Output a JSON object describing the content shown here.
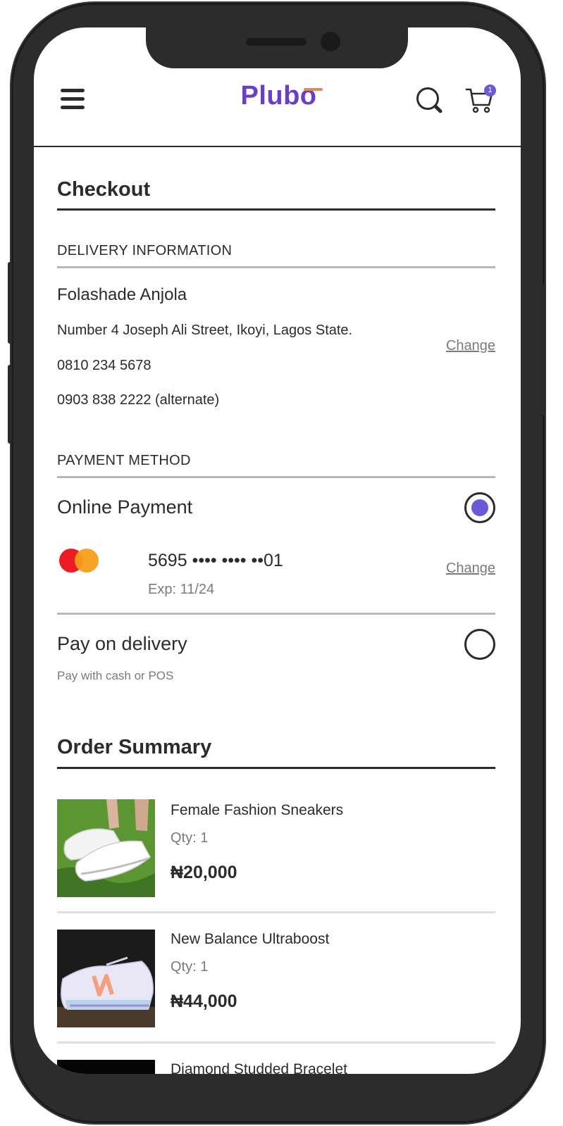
{
  "header": {
    "logo_text": "Plubo",
    "cart_count": "1"
  },
  "checkout": {
    "title": "Checkout"
  },
  "delivery": {
    "section_label": "DELIVERY INFORMATION",
    "name": "Folashade Anjola",
    "address": "Number 4 Joseph Ali Street, Ikoyi, Lagos State.",
    "phone": "0810 234 5678",
    "alt_phone": "0903 838 2222 (alternate)",
    "change_label": "Change"
  },
  "payment": {
    "section_label": "PAYMENT METHOD",
    "online": {
      "label": "Online Payment",
      "selected": true,
      "card_number": "5695 •••• •••• ••01",
      "card_expiry": "Exp: 11/24",
      "change_label": "Change"
    },
    "delivery_option": {
      "label": "Pay on delivery",
      "description": "Pay with cash or POS",
      "selected": false
    }
  },
  "order_summary": {
    "title": "Order Summary",
    "items": [
      {
        "name": "Female Fashion Sneakers",
        "qty": "Qty: 1",
        "price": "₦20,000"
      },
      {
        "name": "New Balance Ultraboost",
        "qty": "Qty: 1",
        "price": "₦44,000"
      },
      {
        "name": "Diamond Studded Bracelet"
      }
    ]
  },
  "colors": {
    "brand": "#6a3fc7",
    "accent": "#6a5ad8",
    "text": "#2b2b2b",
    "muted": "#7a7a7a"
  }
}
